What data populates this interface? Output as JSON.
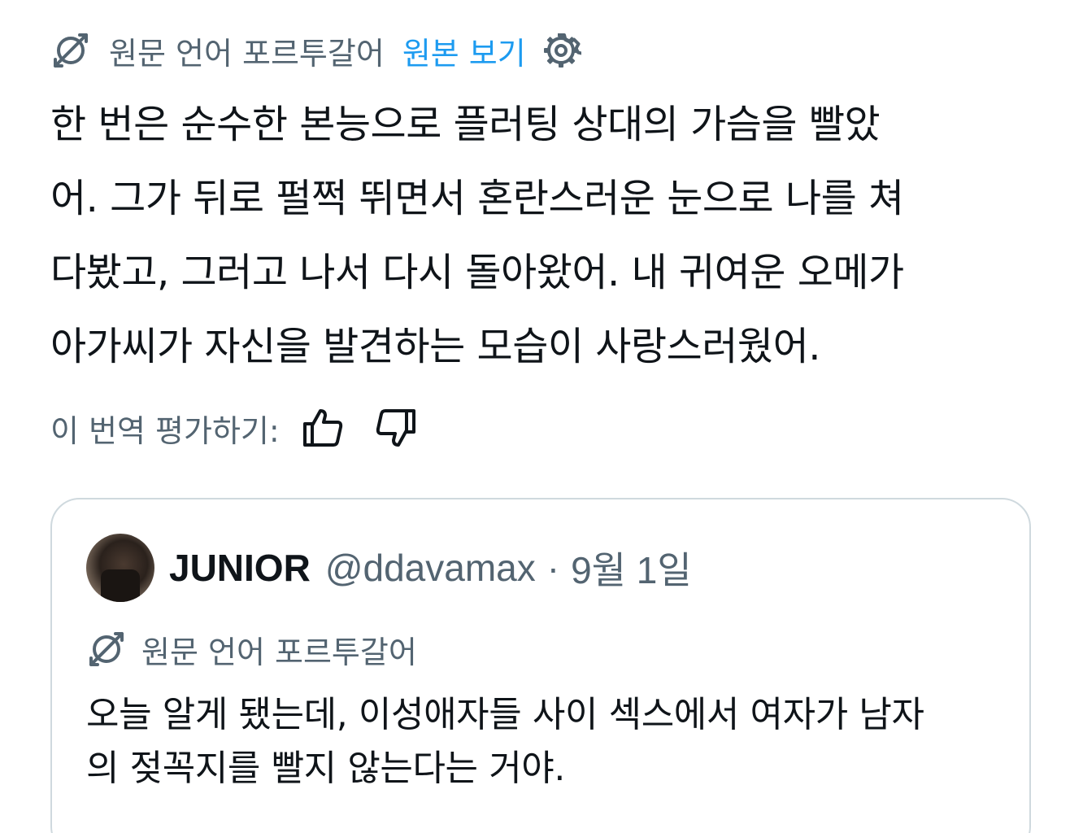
{
  "translation": {
    "label": "원문 언어 포르투갈어",
    "show_original": "원본 보기",
    "icon": "translate-icon",
    "settings_icon": "gear-icon"
  },
  "tweet": {
    "text": "한 번은 순수한 본능으로 플러팅 상대의 가슴을 빨았\n어. 그가 뒤로 펄쩍 뛰면서 혼란스러운 눈으로 나를 쳐\n다봤고, 그러고 나서 다시 돌아왔어. 내 귀여운 오메가\n아가씨가 자신을 발견하는 모습이 사랑스러웠어."
  },
  "rating": {
    "label": "이 번역 평가하기:",
    "thumbs_up_icon": "thumbs-up-icon",
    "thumbs_down_icon": "thumbs-down-icon"
  },
  "quote": {
    "display_name": "JUNIOR",
    "handle": "@ddavamax",
    "separator": "·",
    "date": "9월 1일",
    "translation_label": "원문 언어 포르투갈어",
    "text": "오늘 알게 됐는데, 이성애자들 사이 섹스에서 여자가 남자\n의 젖꼭지를 빨지 않는다는 거야."
  },
  "colors": {
    "text": "#0f1419",
    "secondary": "#536471",
    "link": "#1d9bf0",
    "border": "#cfd9de"
  }
}
